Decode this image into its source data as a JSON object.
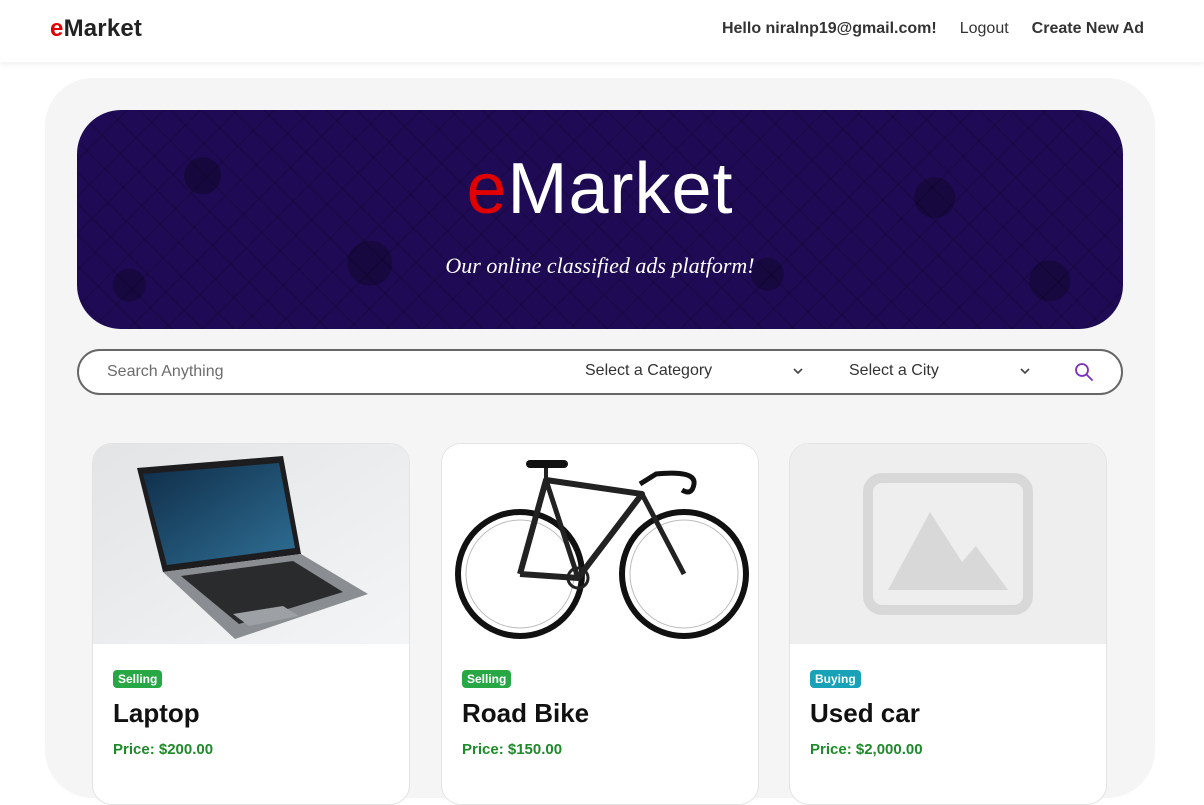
{
  "nav": {
    "brand_e": "e",
    "brand_rest": "Market",
    "greeting": "Hello niralnp19@gmail.com!",
    "logout": "Logout",
    "create": "Create New Ad"
  },
  "hero": {
    "title_e": "e",
    "title_rest": "Market",
    "subtitle": "Our online classified ads platform!"
  },
  "search": {
    "placeholder": "Search Anything",
    "category_label": "Select a Category",
    "city_label": "Select a City"
  },
  "ads": [
    {
      "badge": "Selling",
      "badge_color": "#28a745",
      "title": "Laptop",
      "price": "Price: $200.00"
    },
    {
      "badge": "Selling",
      "badge_color": "#28a745",
      "title": "Road Bike",
      "price": "Price: $150.00"
    },
    {
      "badge": "Buying",
      "badge_color": "#17a2b8",
      "title": "Used car",
      "price": "Price: $2,000.00"
    }
  ],
  "colors": {
    "brand_red": "#e00000",
    "hero_bg": "#1f0a55",
    "price_green": "#1e8a2a",
    "search_icon": "#7b2fbf"
  }
}
